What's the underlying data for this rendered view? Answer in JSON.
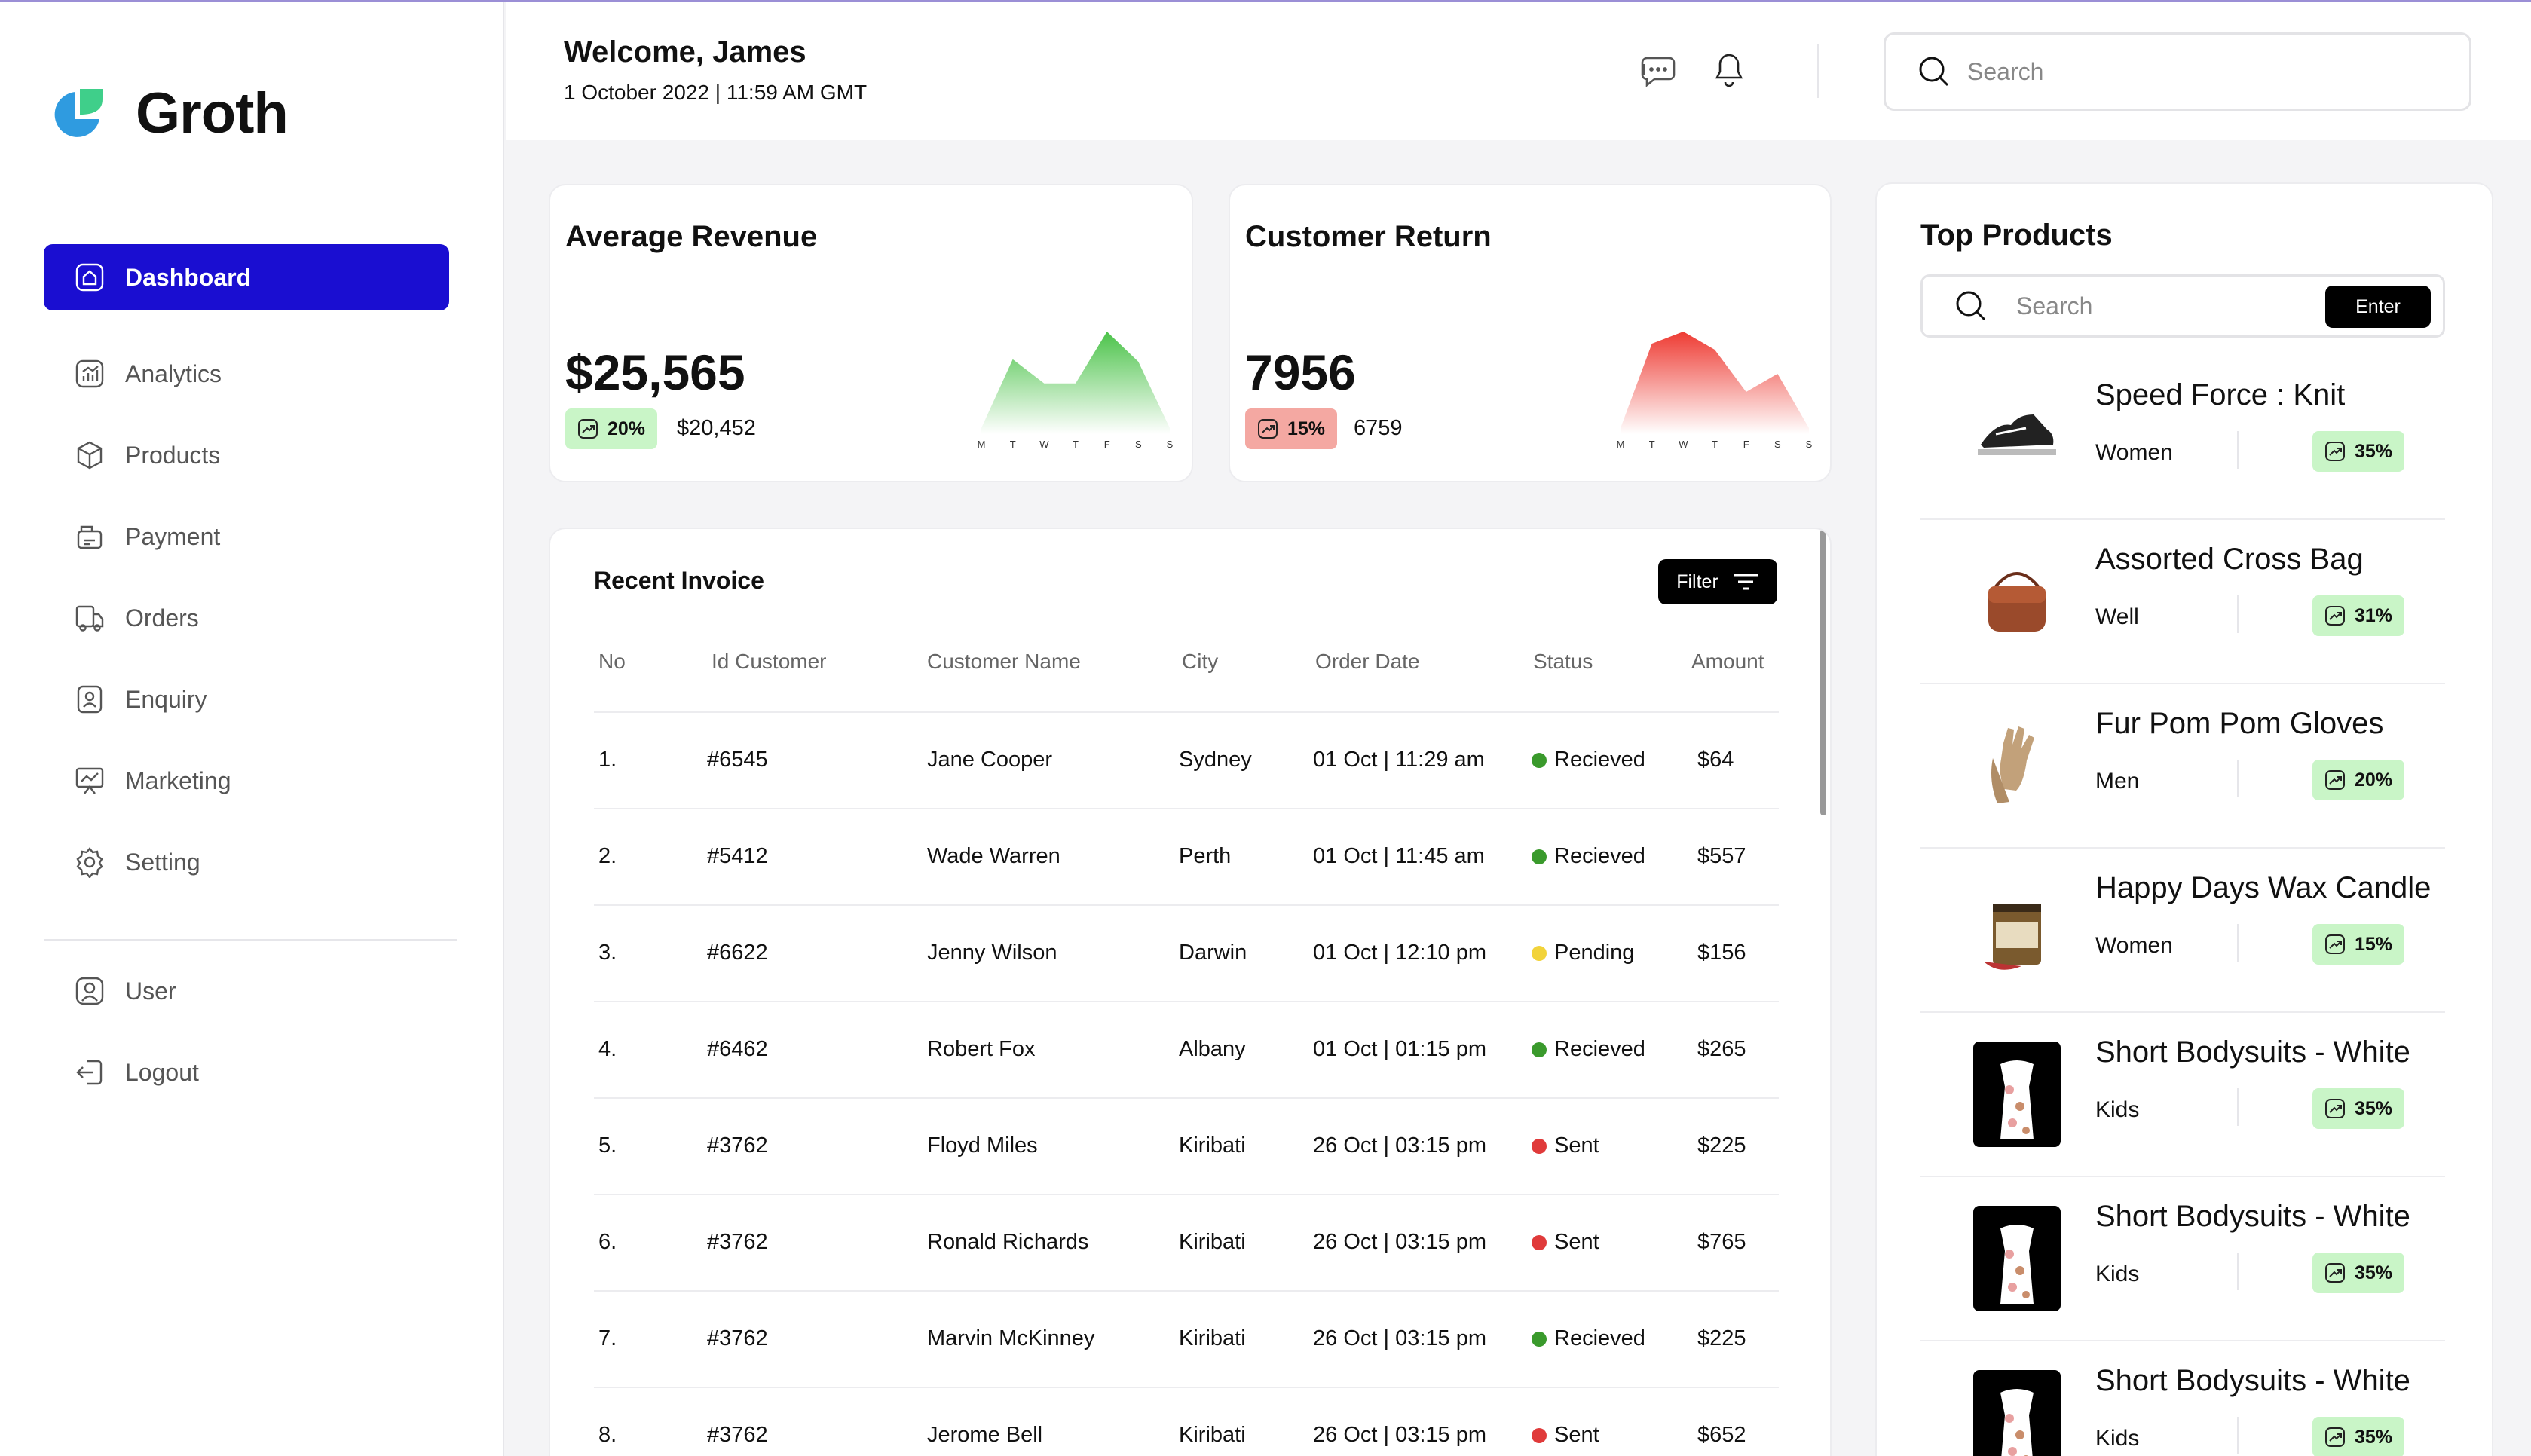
{
  "app": {
    "name": "Groth",
    "brand_colors": {
      "primary": "#1a0ed1",
      "positive": "#c9f5c7",
      "negative": "#f4a8a2"
    }
  },
  "sidebar": {
    "items": [
      {
        "label": "Dashboard",
        "icon": "home-icon",
        "active": true
      },
      {
        "label": "Analytics",
        "icon": "analytics-icon"
      },
      {
        "label": "Products",
        "icon": "box-icon"
      },
      {
        "label": "Payment",
        "icon": "payment-icon"
      },
      {
        "label": "Orders",
        "icon": "truck-icon"
      },
      {
        "label": "Enquiry",
        "icon": "enquiry-icon"
      },
      {
        "label": "Marketing",
        "icon": "marketing-icon"
      },
      {
        "label": "Setting",
        "icon": "gear-icon"
      }
    ],
    "footer_items": [
      {
        "label": "User",
        "icon": "user-icon"
      },
      {
        "label": "Logout",
        "icon": "logout-icon"
      }
    ]
  },
  "header": {
    "welcome": "Welcome, James",
    "datetime": "1 October 2022 | 11:59 AM GMT",
    "search_placeholder": "Search"
  },
  "revenue_card": {
    "title": "Average Revenue",
    "value": "$25,565",
    "change": "20%",
    "previous": "$20,452",
    "days": [
      "M",
      "T",
      "W",
      "T",
      "F",
      "S",
      "S"
    ],
    "trend": [
      5,
      62,
      42,
      42,
      85,
      60,
      5
    ]
  },
  "return_card": {
    "title": "Customer Return",
    "value": "7956",
    "change": "15%",
    "previous": "6759",
    "days": [
      "M",
      "T",
      "W",
      "T",
      "F",
      "S",
      "S"
    ],
    "trend": [
      5,
      75,
      85,
      70,
      35,
      50,
      5
    ]
  },
  "invoice": {
    "title": "Recent Invoice",
    "filter_label": "Filter",
    "columns": [
      "No",
      "Id Customer",
      "Customer Name",
      "City",
      "Order Date",
      "Status",
      "Amount"
    ],
    "rows": [
      {
        "no": "1.",
        "id": "#6545",
        "name": "Jane Cooper",
        "city": "Sydney",
        "date": "01 Oct | 11:29 am",
        "status": "Recieved",
        "status_color": "#3a9a2c",
        "amount": "$64"
      },
      {
        "no": "2.",
        "id": "#5412",
        "name": "Wade Warren",
        "city": "Perth",
        "date": "01 Oct | 11:45 am",
        "status": "Recieved",
        "status_color": "#3a9a2c",
        "amount": "$557"
      },
      {
        "no": "3.",
        "id": "#6622",
        "name": "Jenny Wilson",
        "city": "Darwin",
        "date": "01 Oct | 12:10 pm",
        "status": "Pending",
        "status_color": "#f2d33a",
        "amount": "$156"
      },
      {
        "no": "4.",
        "id": "#6462",
        "name": "Robert Fox",
        "city": "Albany",
        "date": "01 Oct | 01:15 pm",
        "status": "Recieved",
        "status_color": "#3a9a2c",
        "amount": "$265"
      },
      {
        "no": "5.",
        "id": "#3762",
        "name": "Floyd Miles",
        "city": "Kiribati",
        "date": "26 Oct | 03:15 pm",
        "status": "Sent",
        "status_color": "#e03a3a",
        "amount": "$225"
      },
      {
        "no": "6.",
        "id": "#3762",
        "name": "Ronald Richards",
        "city": "Kiribati",
        "date": "26 Oct | 03:15 pm",
        "status": "Sent",
        "status_color": "#e03a3a",
        "amount": "$765"
      },
      {
        "no": "7.",
        "id": "#3762",
        "name": "Marvin McKinney",
        "city": "Kiribati",
        "date": "26 Oct | 03:15 pm",
        "status": "Recieved",
        "status_color": "#3a9a2c",
        "amount": "$225"
      },
      {
        "no": "8.",
        "id": "#3762",
        "name": "Jerome Bell",
        "city": "Kiribati",
        "date": "26 Oct | 03:15 pm",
        "status": "Sent",
        "status_color": "#e03a3a",
        "amount": "$652"
      }
    ]
  },
  "top_products": {
    "title": "Top Products",
    "search_placeholder": "Search",
    "enter_label": "Enter",
    "items": [
      {
        "name": "Speed Force : Knit",
        "category": "Women",
        "change": "35%",
        "image": "sneaker"
      },
      {
        "name": "Assorted Cross Bag",
        "category": "Well",
        "change": "31%",
        "image": "bag"
      },
      {
        "name": "Fur Pom Pom Gloves",
        "category": "Men",
        "change": "20%",
        "image": "gloves"
      },
      {
        "name": "Happy Days Wax Candle",
        "category": "Women",
        "change": "15%",
        "image": "candle"
      },
      {
        "name": "Short Bodysuits - White",
        "category": "Kids",
        "change": "35%",
        "image": "bodysuit"
      },
      {
        "name": "Short Bodysuits - White",
        "category": "Kids",
        "change": "35%",
        "image": "bodysuit"
      },
      {
        "name": "Short Bodysuits - White",
        "category": "Kids",
        "change": "35%",
        "image": "bodysuit"
      }
    ]
  }
}
